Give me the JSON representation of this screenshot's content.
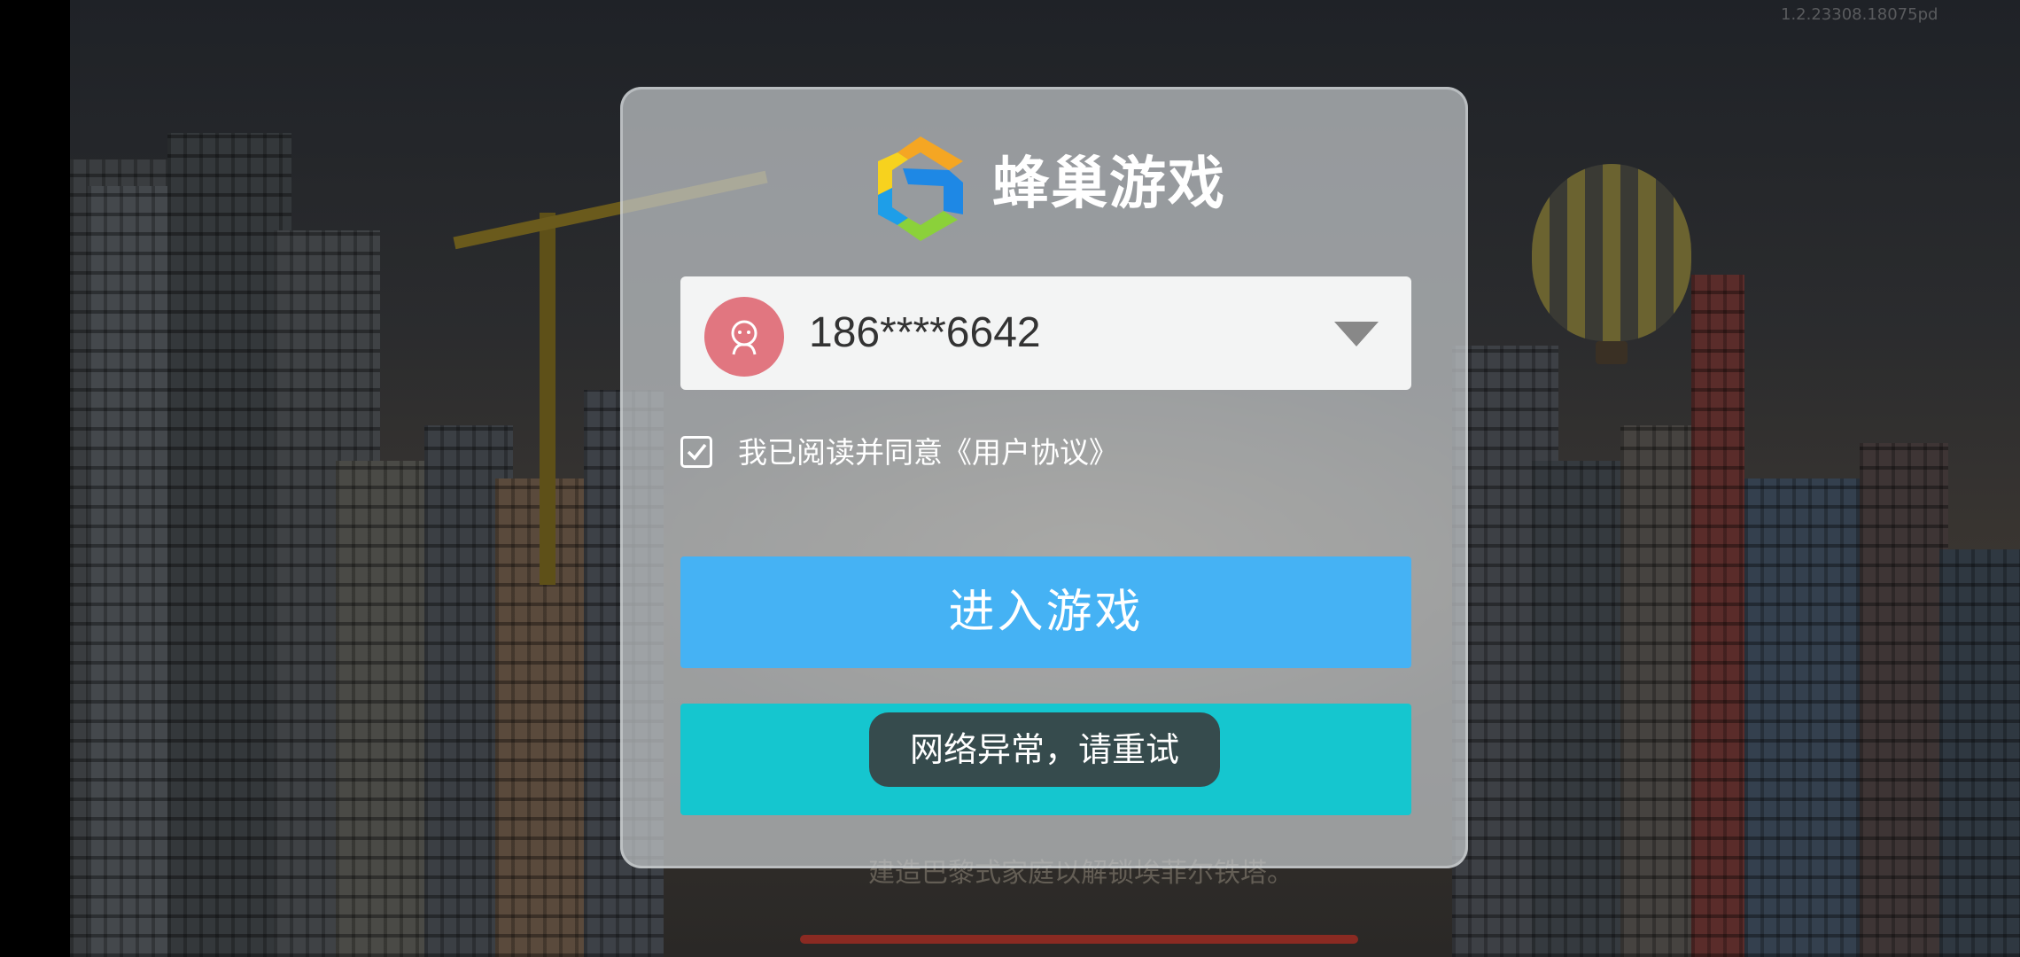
{
  "app": {
    "version_text": "1.2.23308.18075pd",
    "background_caption": "建造巴黎式家庭以解锁埃菲尔铁塔。"
  },
  "dialog": {
    "brand_name": "蜂巢游戏",
    "account": {
      "value": "186****6642"
    },
    "agreement": {
      "checked": true,
      "text": "我已阅读并同意《用户协议》"
    },
    "enter_button_label": "进入游戏",
    "toast_text": "网络异常，请重试"
  },
  "colors": {
    "enter_button": "#45b2f4",
    "secondary_button": "#15c6cf",
    "avatar": "#e17680"
  }
}
